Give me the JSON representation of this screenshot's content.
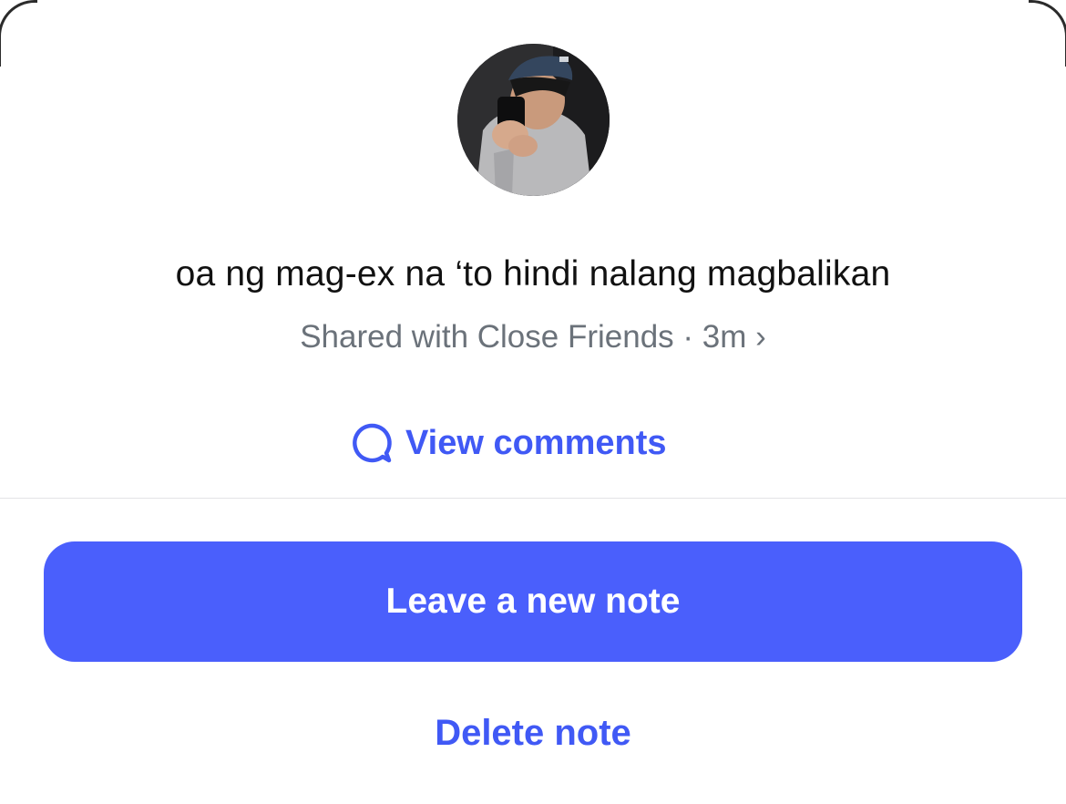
{
  "note": {
    "text": "oa ng mag-ex na ‘to hindi nalang magbalikan",
    "meta": "Shared with Close Friends · 3m ›"
  },
  "actions": {
    "view_comments_label": "View comments",
    "primary_label": "Leave a new note",
    "delete_label": "Delete note"
  },
  "icons": {
    "comment": "comment-bubble-icon"
  },
  "colors": {
    "accent": "#4a5ffc",
    "link": "#4059f5",
    "text": "#111111",
    "secondary_text": "#6b727a",
    "divider": "#e3e3e6"
  }
}
